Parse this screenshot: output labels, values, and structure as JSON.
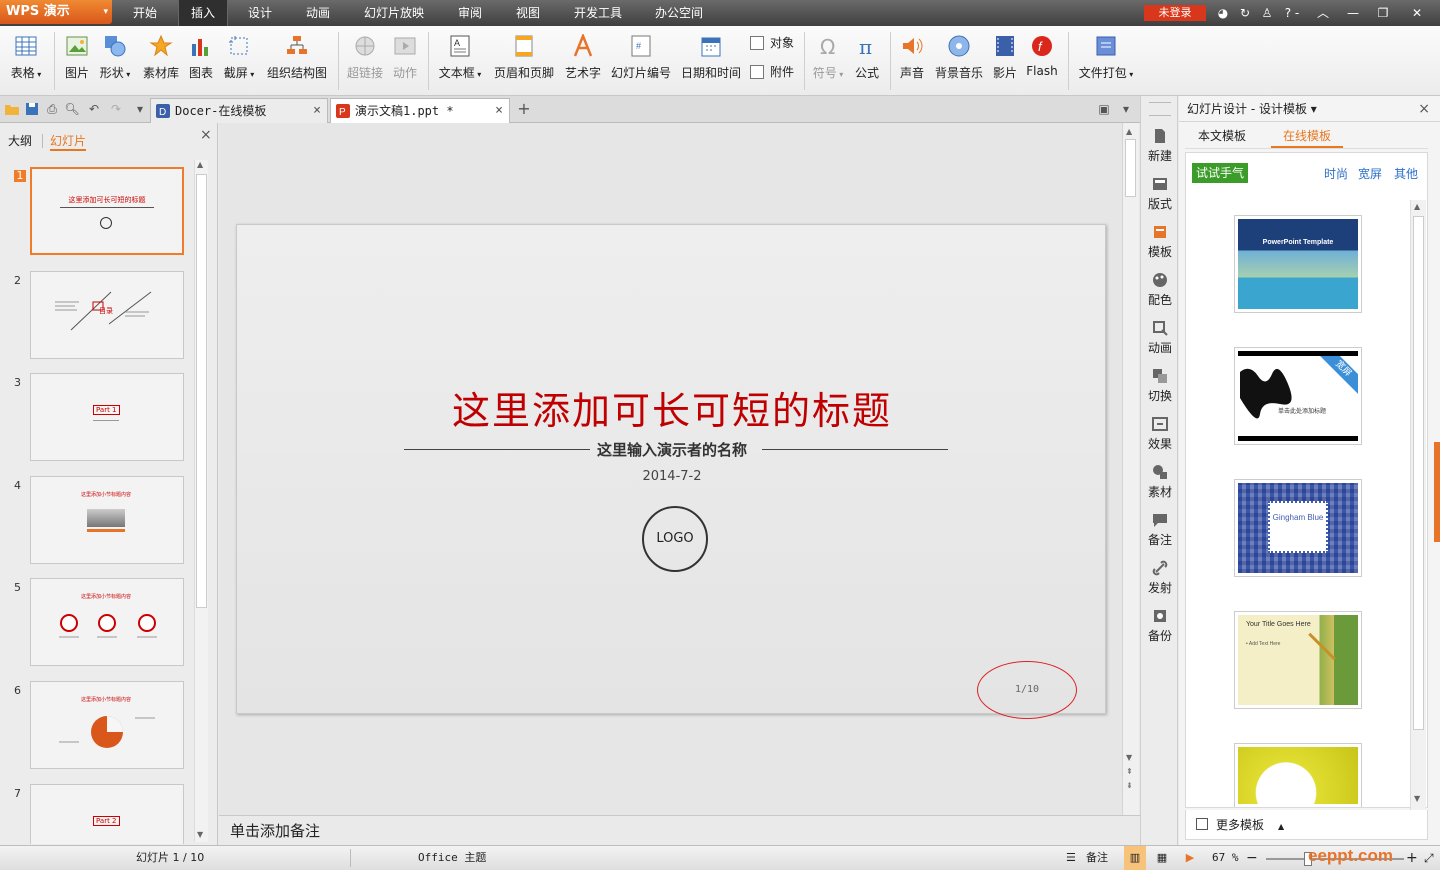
{
  "app": {
    "logo": "WPS 演示",
    "logo_arrow": "▾"
  },
  "menu": {
    "tabs": [
      "开始",
      "插入",
      "设计",
      "动画",
      "幻灯片放映",
      "审阅",
      "视图",
      "开发工具",
      "办公空间"
    ],
    "active": "插入",
    "login": "未登录",
    "help": "? -"
  },
  "ribbon": {
    "table": "表格",
    "picture": "图片",
    "shape": "形状",
    "material": "素材库",
    "chart": "图表",
    "screenshot": "截屏",
    "orgchart": "组织结构图",
    "hyperlink": "超链接",
    "action": "动作",
    "textbox": "文本框",
    "header_footer": "页眉和页脚",
    "wordart": "艺术字",
    "slide_number": "幻灯片编号",
    "datetime": "日期和时间",
    "object": "对象",
    "attachment": "附件",
    "symbol": "符号",
    "formula": "公式",
    "sound": "声音",
    "bgmusic": "背景音乐",
    "movie": "影片",
    "flash": "Flash",
    "package": "文件打包"
  },
  "tabs": {
    "doc1": "Docer-在线模板",
    "doc2": "演示文稿1.ppt *",
    "close": "×",
    "add": "+"
  },
  "leftpanel": {
    "outline": "大纲",
    "slides": "幻灯片",
    "close": "×",
    "thumbs": [
      {
        "num": "1",
        "title": "这里添加可长可短的标题"
      },
      {
        "num": "2",
        "title": "目录"
      },
      {
        "num": "3",
        "title": "Part 1"
      },
      {
        "num": "4",
        "title": "这里添加小节标题内容"
      },
      {
        "num": "5",
        "title": "这里添加小节标题内容"
      },
      {
        "num": "6",
        "title": "这里添加小节标题内容"
      },
      {
        "num": "7",
        "title": "Part 2"
      }
    ]
  },
  "slide": {
    "title": "这里添加可长可短的标题",
    "subtitle": "这里输入演示者的名称",
    "date": "2014-7-2",
    "logo": "LOGO",
    "page": "1/10"
  },
  "notes": {
    "placeholder": "单击添加备注"
  },
  "sidetools": [
    "新建",
    "版式",
    "模板",
    "配色",
    "动画",
    "切换",
    "效果",
    "素材",
    "备注",
    "发射",
    "备份"
  ],
  "rightpanel": {
    "title": "幻灯片设计 - 设计模板 ▾",
    "close": "×",
    "tab_local": "本文模板",
    "tab_online": "在线模板",
    "try": "试试手气",
    "cat1": "时尚",
    "cat2": "宽屏",
    "cat3": "其他",
    "tpl1": "PowerPoint Template",
    "tpl2_badge": "宽屏",
    "tpl2_title": "单击此处添加标题",
    "tpl3": "Gingham Blue",
    "tpl4": "Your Title Goes Here",
    "tpl4_sub": "• Add Text Here",
    "more": "更多模板"
  },
  "status": {
    "slide_info": "幻灯片 1 / 10",
    "theme": "Office 主题",
    "notes": "备注",
    "zoom": "67 %",
    "watermark": "eeppt.com"
  },
  "colors": {
    "accent": "#f07c2a",
    "title_red": "#c00000",
    "green": "#3c9c2a",
    "link_blue": "#2a6fc9"
  }
}
